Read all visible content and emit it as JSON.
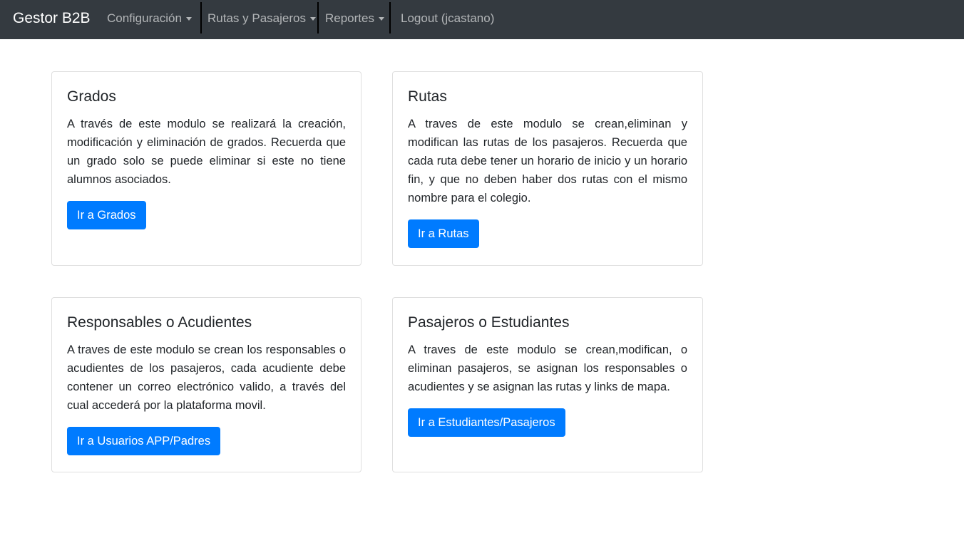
{
  "navbar": {
    "brand": "Gestor B2B",
    "items": [
      {
        "label": "Configuración"
      },
      {
        "label": "Rutas y Pasajeros"
      },
      {
        "label": "Reportes"
      },
      {
        "label": "Logout (jcastano)"
      }
    ]
  },
  "cards": [
    {
      "title": "Grados",
      "text": "A través de este modulo se realizará la creación, modificación y eliminación de grados. Recuerda que un grado solo se puede eliminar si este no tiene alumnos asociados.",
      "button": "Ir a Grados"
    },
    {
      "title": "Rutas",
      "text": "A traves de este modulo se crean,eliminan y modifican las rutas de los pasajeros. Recuerda que cada ruta debe tener un horario de inicio y un horario fin, y que no deben haber dos rutas con el mismo nombre para el colegio.",
      "button": "Ir a Rutas"
    },
    {
      "title": "Responsables o Acudientes",
      "text": "A traves de este modulo se crean los responsables o acudientes de los pasajeros, cada acudiente debe contener un correo electrónico valido, a través del cual accederá por la plataforma movil.",
      "button": "Ir a Usuarios APP/Padres"
    },
    {
      "title": "Pasajeros o Estudiantes",
      "text": "A traves de este modulo se crean,modifican, o eliminan pasajeros, se asignan los responsables o acudientes y se asignan las rutas y links de mapa.",
      "button": "Ir a Estudiantes/Pasajeros"
    }
  ],
  "colors": {
    "navbar_bg": "#343a40",
    "primary": "#007bff"
  }
}
